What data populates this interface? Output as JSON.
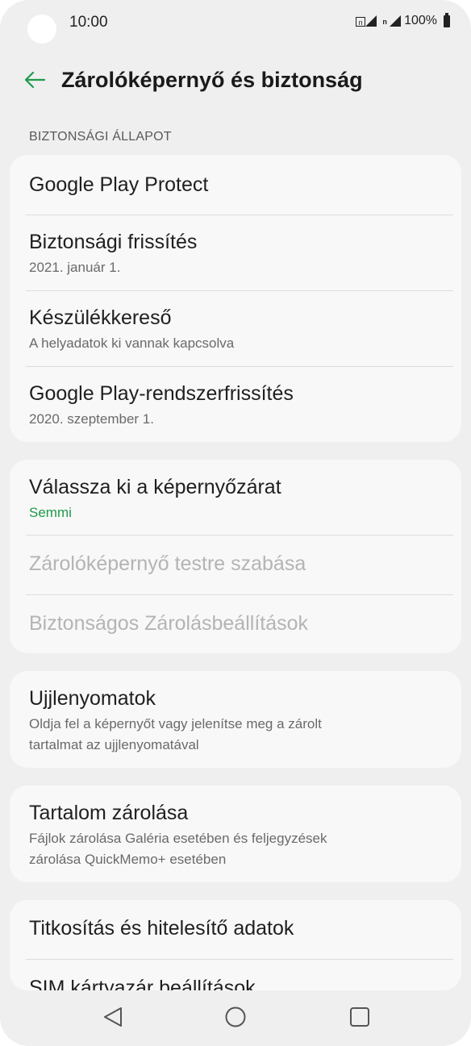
{
  "status_bar": {
    "time": "10:00",
    "sim_label": "n",
    "battery": "100%",
    "icons": [
      "signal-icon",
      "battery-icon"
    ]
  },
  "header": {
    "title": "Zárolóképernyő és biztonság",
    "accent_color": "#1f9a49",
    "back_icon": "arrow-left-icon"
  },
  "sections": {
    "security_status_label": "BIZTONSÁGI ÁLLAPOT"
  },
  "security_card": {
    "items": [
      {
        "title": "Google Play Protect",
        "subtitle": ""
      },
      {
        "title": "Biztonsági frissítés",
        "subtitle": "2021. január 1."
      },
      {
        "title": "Készülékkereső",
        "subtitle": "A helyadatok ki vannak kapcsolva"
      },
      {
        "title": "Google Play-rendszerfrissítés",
        "subtitle": "2020. szeptember 1."
      }
    ]
  },
  "lock_card": {
    "items": [
      {
        "title": "Válassza ki a képernyőzárat",
        "subtitle": "Semmi",
        "enabled": true
      },
      {
        "title": "Zárolóképernyő testre szabása",
        "subtitle": "",
        "enabled": false
      },
      {
        "title": "Biztonságos Zárolásbeállítások",
        "subtitle": "",
        "enabled": false
      }
    ]
  },
  "fingerprint_card": {
    "title": "Ujjlenyomatok",
    "subtitle_line1": "Oldja fel a képernyőt vagy jelenítse meg a zárolt",
    "subtitle_line2": "tartalmat az ujjlenyomatával"
  },
  "content_lock_card": {
    "title": "Tartalom zárolása",
    "subtitle_line1": "Fájlok zárolása Galéria esetében és feljegyzések",
    "subtitle_line2": "zárolása QuickMemo+ esetében"
  },
  "encryption_card": {
    "items": [
      {
        "title": "Titkosítás és hitelesítő adatok"
      },
      {
        "title": "SIM kártyazár beállítások"
      }
    ]
  },
  "nav_bar": {
    "buttons": [
      "back-triangle-icon",
      "home-circle-icon",
      "recents-square-icon"
    ]
  }
}
